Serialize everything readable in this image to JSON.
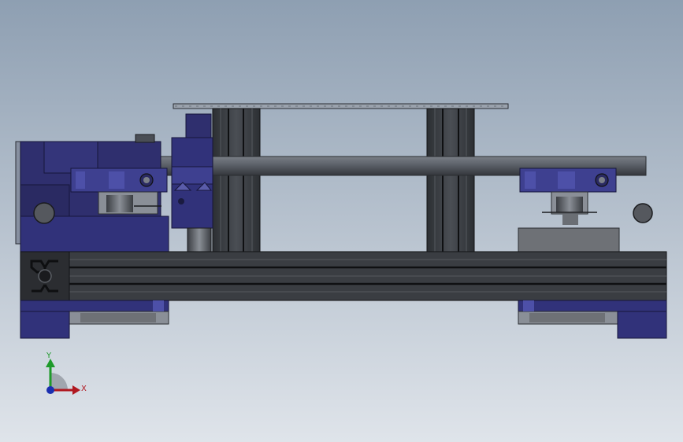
{
  "viewport": {
    "background_top": "#8e9fb2",
    "background_bottom": "#dfe4ea"
  },
  "triad": {
    "x_label": "X",
    "y_label": "Y",
    "x_color": "#b01820",
    "y_color": "#1e9a2a",
    "z_color": "#1a2fb0"
  },
  "colors": {
    "navy_part": "#2f2f6e",
    "navy_light": "#3e4090",
    "extrusion": "#3a3d42",
    "extrusion_groove": "#0f1012",
    "rod": "#5b6068",
    "grey_block": "#6e7176"
  }
}
